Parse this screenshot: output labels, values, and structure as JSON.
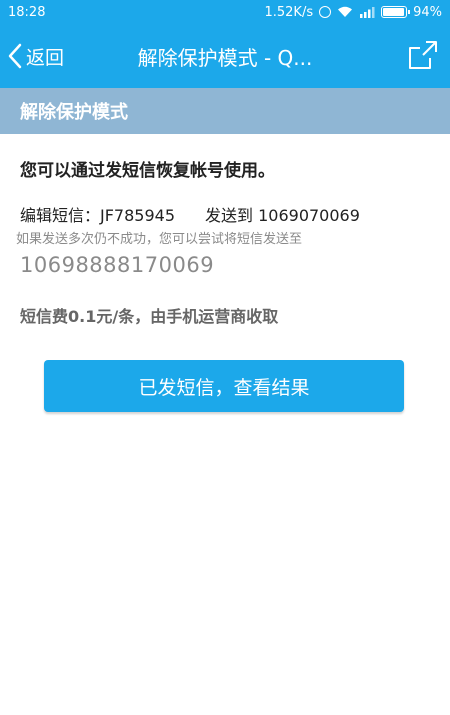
{
  "status_bar": {
    "time": "18:28",
    "network_speed": "1.52K/s",
    "battery": "94%",
    "battery_level": 0.94,
    "icons": [
      "alarm-icon",
      "wifi-icon",
      "signal-icon",
      "battery-icon"
    ]
  },
  "header": {
    "back_label": "返回",
    "title": "解除保护模式 - Q...",
    "share_icon": "share-icon",
    "color": "#1ca8ea"
  },
  "section": {
    "title": "解除保护模式",
    "color": "#8fb6d4"
  },
  "content": {
    "intro": "您可以通过发短信恢复帐号使用。",
    "sms_label": "编辑短信：JF785945",
    "send_to_label": "发送到 1069070069",
    "retry_hint": "如果发送多次仍不成功，您可以尝试将短信发送至",
    "alt_number": "10698888170069",
    "fee_note": "短信费0.1元/条，由手机运营商收取"
  },
  "actions": {
    "confirm_label": "已发短信，查看结果"
  }
}
